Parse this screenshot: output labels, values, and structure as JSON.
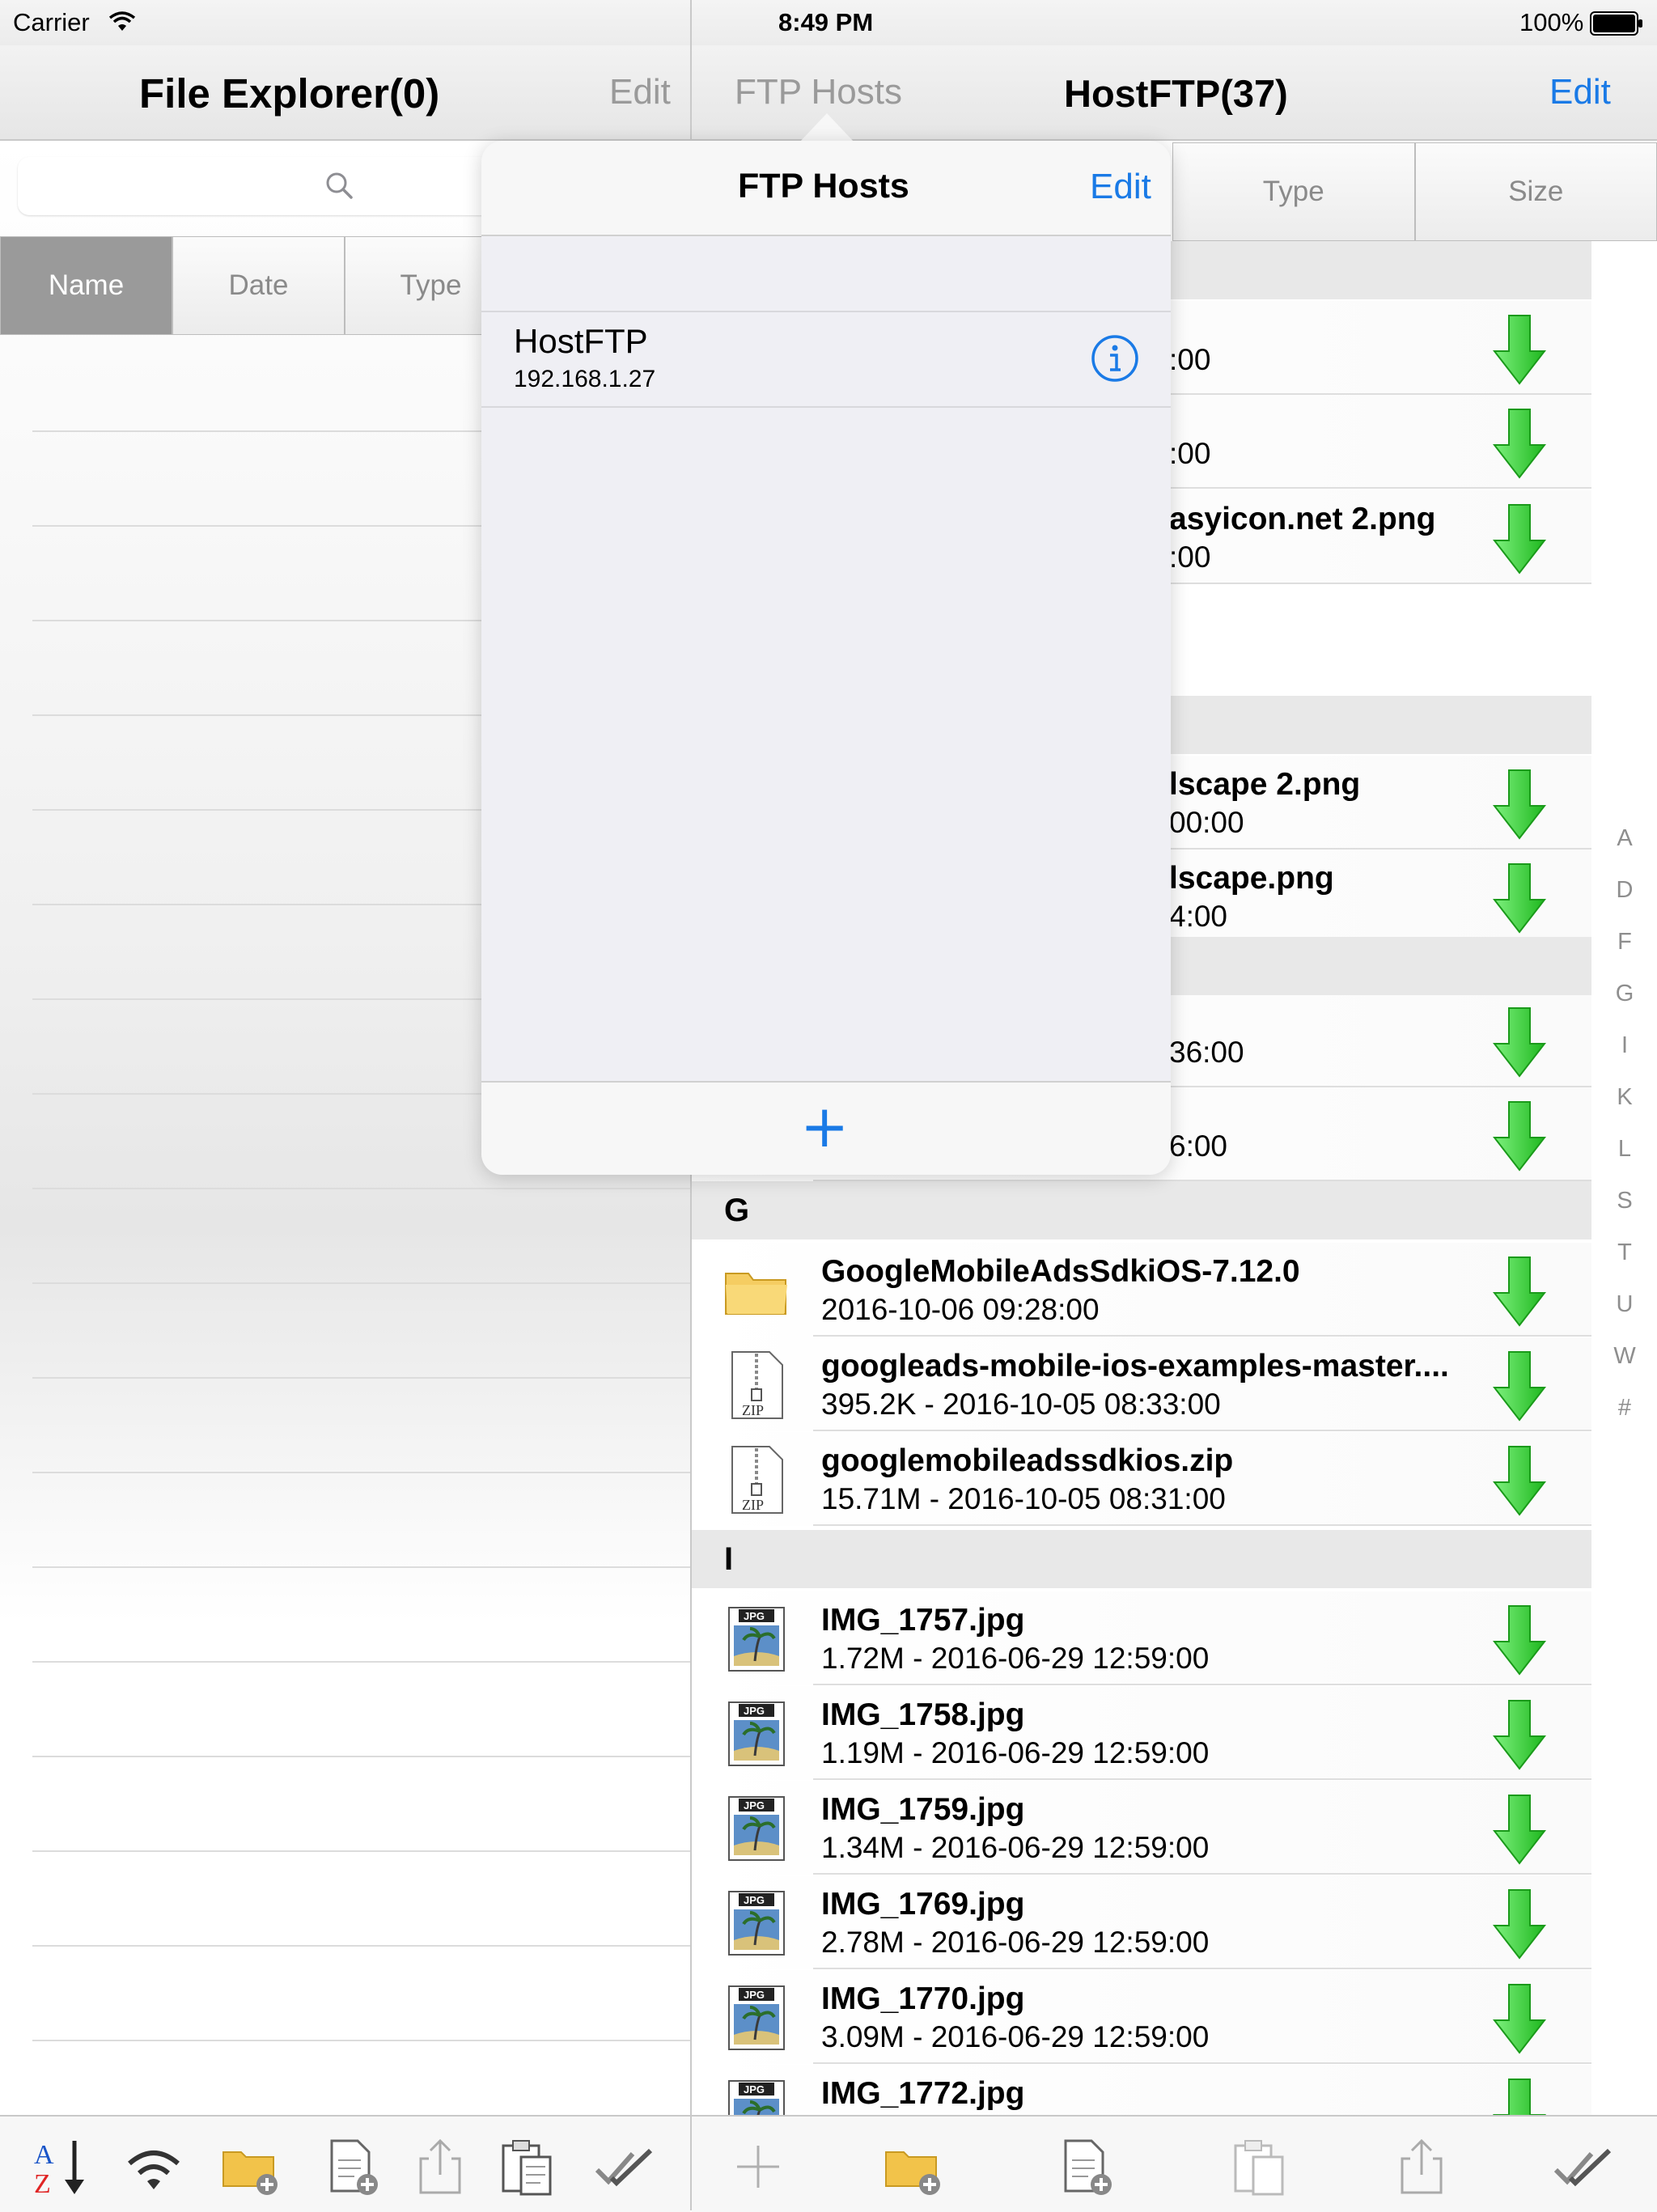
{
  "status": {
    "carrier": "Carrier",
    "time": "8:49 PM",
    "battery": "100%"
  },
  "left": {
    "title": "File Explorer(0)",
    "edit": "Edit",
    "sort_segments": [
      "Name",
      "Date",
      "Type"
    ]
  },
  "right": {
    "back": "FTP Hosts",
    "title": "HostFTP(37)",
    "edit": "Edit",
    "sort_segments": [
      "Type",
      "Size"
    ],
    "partial_rows": [
      {
        "meta": ":00"
      },
      {
        "meta": ":00"
      },
      {
        "name": "asyicon.net 2.png",
        "meta": ":00"
      },
      {
        "name": "lscape 2.png",
        "meta": "00:00"
      },
      {
        "name": "lscape.png",
        "meta": "4:00"
      },
      {
        "meta": "36:00"
      },
      {
        "meta": "6:00"
      }
    ],
    "sections": [
      {
        "letter": "G",
        "rows": [
          {
            "icon": "folder-icon",
            "name": "GoogleMobileAdsSdkiOS-7.12.0",
            "meta": "2016-10-06 09:28:00"
          },
          {
            "icon": "zip-icon",
            "name": "googleads-mobile-ios-examples-master....",
            "meta": "395.2K - 2016-10-05 08:33:00"
          },
          {
            "icon": "zip-icon",
            "name": "googlemobileadssdkios.zip",
            "meta": "15.71M - 2016-10-05 08:31:00"
          }
        ]
      },
      {
        "letter": "I",
        "rows": [
          {
            "icon": "jpg-icon",
            "name": "IMG_1757.jpg",
            "meta": "1.72M - 2016-06-29 12:59:00"
          },
          {
            "icon": "jpg-icon",
            "name": "IMG_1758.jpg",
            "meta": "1.19M - 2016-06-29 12:59:00"
          },
          {
            "icon": "jpg-icon",
            "name": "IMG_1759.jpg",
            "meta": "1.34M - 2016-06-29 12:59:00"
          },
          {
            "icon": "jpg-icon",
            "name": "IMG_1769.jpg",
            "meta": "2.78M - 2016-06-29 12:59:00"
          },
          {
            "icon": "jpg-icon",
            "name": "IMG_1770.jpg",
            "meta": "3.09M - 2016-06-29 12:59:00"
          },
          {
            "icon": "jpg-icon",
            "name": "IMG_1772.jpg",
            "meta": ""
          }
        ]
      }
    ],
    "index": [
      "A",
      "D",
      "F",
      "G",
      "I",
      "K",
      "L",
      "S",
      "T",
      "U",
      "W",
      "#"
    ]
  },
  "popover": {
    "title": "FTP Hosts",
    "edit": "Edit",
    "host_name": "HostFTP",
    "host_ip": "192.168.1.27",
    "add": "+"
  },
  "colors": {
    "accent": "#1a7ae6",
    "download_green": "#3cd43c"
  }
}
